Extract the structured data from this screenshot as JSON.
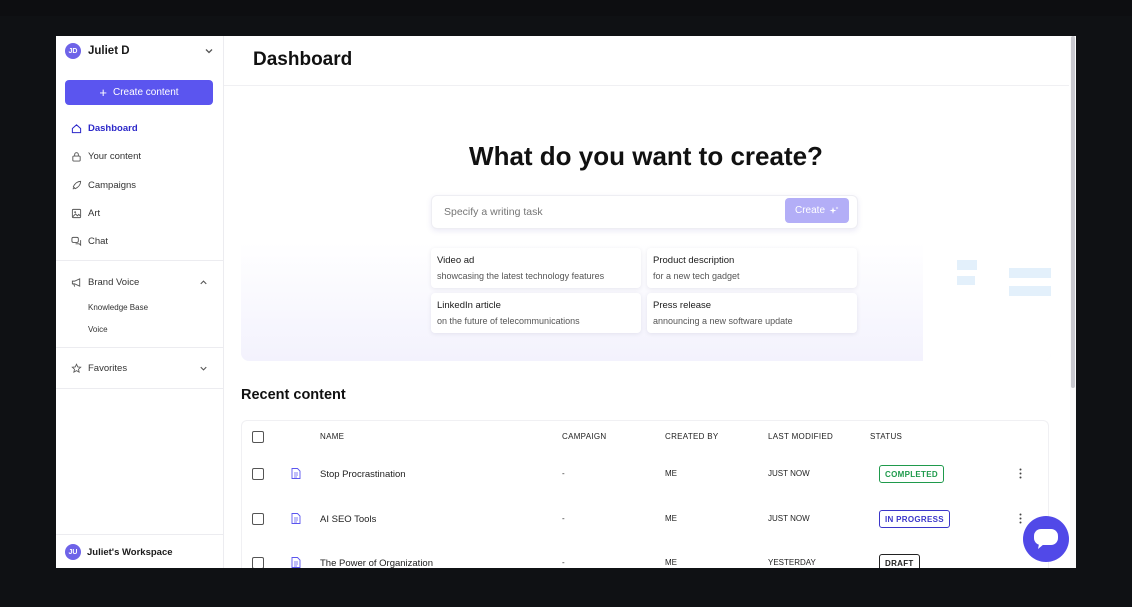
{
  "sidebar": {
    "user_initials": "JD",
    "user_name": "Juliet D",
    "create_button": "Create content",
    "nav": [
      {
        "label": "Dashboard",
        "icon": "home-icon"
      },
      {
        "label": "Your content",
        "icon": "lock-icon"
      },
      {
        "label": "Campaigns",
        "icon": "rocket-icon"
      },
      {
        "label": "Art",
        "icon": "image-icon"
      },
      {
        "label": "Chat",
        "icon": "chat-icon"
      }
    ],
    "brand_voice": {
      "label": "Brand Voice",
      "children": [
        "Knowledge Base",
        "Voice"
      ]
    },
    "favorites": "Favorites",
    "workspace_initials": "JU",
    "workspace_name": "Juliet's Workspace"
  },
  "main": {
    "title": "Dashboard",
    "hero": {
      "title": "What do you want to create?",
      "placeholder": "Specify a writing task",
      "create_button": "Create",
      "suggestions": [
        {
          "title": "Video ad",
          "desc": "showcasing the latest technology features"
        },
        {
          "title": "Product description",
          "desc": "for a new tech gadget"
        },
        {
          "title": "LinkedIn article",
          "desc": "on the future of telecommunications"
        },
        {
          "title": "Press release",
          "desc": "announcing a new software update"
        }
      ]
    },
    "recent": {
      "title": "Recent content",
      "columns": [
        "NAME",
        "CAMPAIGN",
        "CREATED BY",
        "LAST MODIFIED",
        "STATUS"
      ],
      "rows": [
        {
          "name": "Stop Procrastination",
          "campaign": "-",
          "created_by": "ME",
          "modified": "JUST NOW",
          "status": "COMPLETED"
        },
        {
          "name": "AI SEO Tools",
          "campaign": "-",
          "created_by": "ME",
          "modified": "JUST NOW",
          "status": "IN PROGRESS"
        },
        {
          "name": "The Power of Organization",
          "campaign": "-",
          "created_by": "ME",
          "modified": "YESTERDAY",
          "status": "DRAFT"
        }
      ]
    }
  },
  "colors": {
    "accent": "#5b55ef",
    "completed": "#1f9a4c",
    "in_progress": "#3b36c9",
    "draft": "#222222"
  }
}
